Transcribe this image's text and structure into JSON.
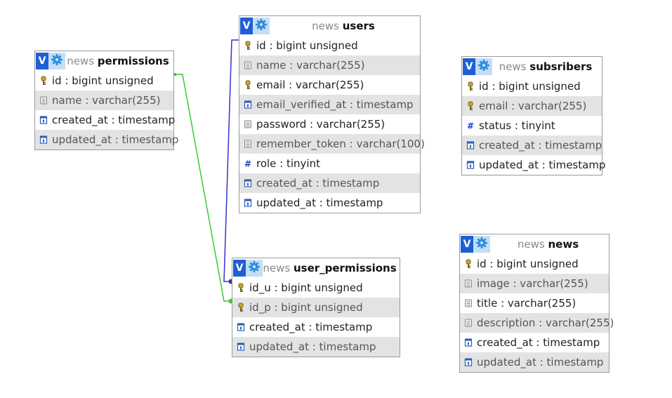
{
  "tables": [
    {
      "key": "permissions",
      "db": "news",
      "name": "permissions",
      "columns": [
        {
          "text": "id : bigint unsigned",
          "icon": "key-icon"
        },
        {
          "text": "name : varchar(255)",
          "icon": "text-field-icon"
        },
        {
          "text": "created_at : timestamp",
          "icon": "calendar-icon"
        },
        {
          "text": "updated_at : timestamp",
          "icon": "calendar-icon"
        }
      ]
    },
    {
      "key": "users",
      "db": "news",
      "name": "users",
      "columns": [
        {
          "text": "id : bigint unsigned",
          "icon": "key-icon"
        },
        {
          "text": "name : varchar(255)",
          "icon": "text-field-icon"
        },
        {
          "text": "email : varchar(255)",
          "icon": "key-icon"
        },
        {
          "text": "email_verified_at : timestamp",
          "icon": "calendar-icon"
        },
        {
          "text": "password : varchar(255)",
          "icon": "text-field-icon"
        },
        {
          "text": "remember_token : varchar(100)",
          "icon": "text-field-icon"
        },
        {
          "text": "role : tinyint",
          "icon": "number-icon"
        },
        {
          "text": "created_at : timestamp",
          "icon": "calendar-icon"
        },
        {
          "text": "updated_at : timestamp",
          "icon": "calendar-icon"
        }
      ]
    },
    {
      "key": "subsribers",
      "db": "news",
      "name": "subsribers",
      "columns": [
        {
          "text": "id : bigint unsigned",
          "icon": "key-icon"
        },
        {
          "text": "email : varchar(255)",
          "icon": "key-icon"
        },
        {
          "text": "status : tinyint",
          "icon": "number-icon"
        },
        {
          "text": "created_at : timestamp",
          "icon": "calendar-icon"
        },
        {
          "text": "updated_at : timestamp",
          "icon": "calendar-icon"
        }
      ]
    },
    {
      "key": "user_permissions",
      "db": "news",
      "name": "user_permissions",
      "columns": [
        {
          "text": "id_u : bigint unsigned",
          "icon": "key-icon"
        },
        {
          "text": "id_p : bigint unsigned",
          "icon": "key-icon"
        },
        {
          "text": "created_at : timestamp",
          "icon": "calendar-icon"
        },
        {
          "text": "updated_at : timestamp",
          "icon": "calendar-icon"
        }
      ]
    },
    {
      "key": "news",
      "db": "news",
      "name": "news",
      "columns": [
        {
          "text": "id : bigint unsigned",
          "icon": "key-icon"
        },
        {
          "text": "image : varchar(255)",
          "icon": "text-field-icon"
        },
        {
          "text": "title : varchar(255)",
          "icon": "text-field-icon"
        },
        {
          "text": "description : varchar(255)",
          "icon": "text-field-icon"
        },
        {
          "text": "created_at : timestamp",
          "icon": "calendar-icon"
        },
        {
          "text": "updated_at : timestamp",
          "icon": "calendar-icon"
        }
      ]
    }
  ],
  "relations": [
    {
      "from_table": "users",
      "from_column": "id",
      "to_table": "user_permissions",
      "to_column": "id_u",
      "color": "#3333cc"
    },
    {
      "from_table": "permissions",
      "from_column": "id",
      "to_table": "user_permissions",
      "to_column": "id_p",
      "color": "#33cc33"
    }
  ],
  "header_buttons": {
    "toggle_label": "V",
    "toggle_icon": "toggle-icon",
    "options_icon": "gear-icon"
  },
  "colors": {
    "header_button_blue": "#1f5fd6",
    "header_button_light": "#c4def4",
    "alt_row": "#e3e3e3",
    "border": "#9a9a9a"
  }
}
